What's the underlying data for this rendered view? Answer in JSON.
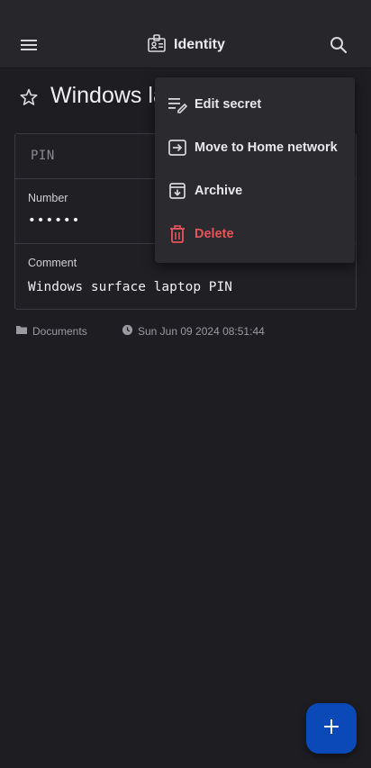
{
  "header": {
    "app_title": "Identity",
    "icons": {
      "menu": "hamburger-menu-icon",
      "app": "id-badge-icon",
      "search": "search-icon"
    }
  },
  "secret": {
    "title": "Windows laptop PIN",
    "favorite_icon": "star-outline-icon",
    "type": "PIN",
    "fields": [
      {
        "label": "Number",
        "value": "••••••"
      },
      {
        "label": "Comment",
        "value": "Windows surface laptop PIN"
      }
    ],
    "folder": "Documents",
    "modified": "Sun Jun 09 2024 08:51:44"
  },
  "context_menu": {
    "items": [
      {
        "label": "Edit secret",
        "icon": "edit-lines-icon"
      },
      {
        "label": "Move to Home network",
        "icon": "move-to-icon"
      },
      {
        "label": "Archive",
        "icon": "archive-icon"
      },
      {
        "label": "Delete",
        "icon": "trash-icon",
        "color": "#e8545a"
      }
    ]
  },
  "fab": {
    "icon": "plus-icon",
    "color": "#0a49b7"
  }
}
